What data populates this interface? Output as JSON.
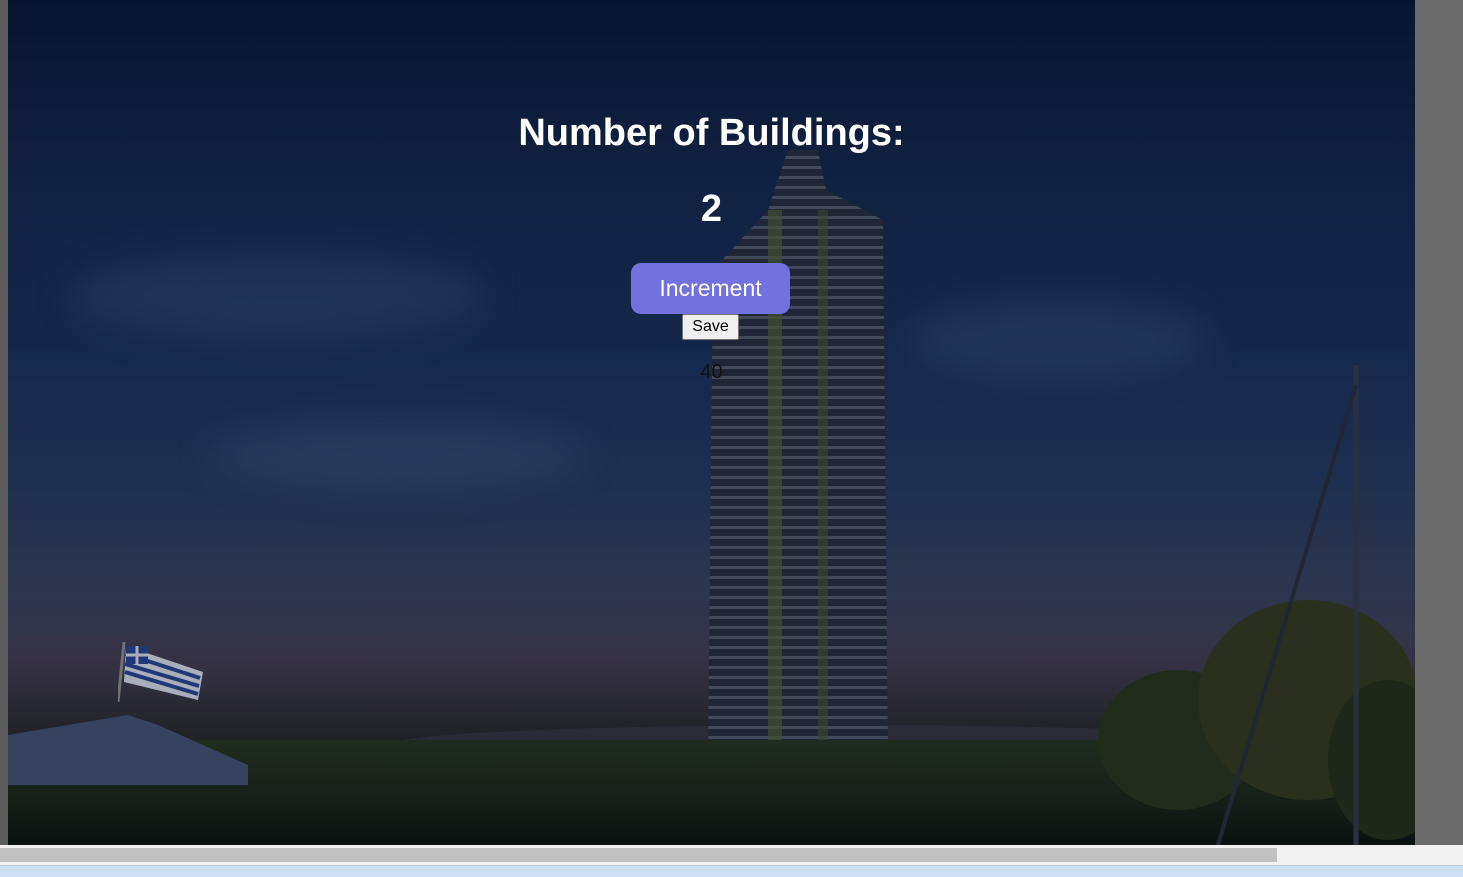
{
  "heading": {
    "label": "Number of Buildings:"
  },
  "counter": {
    "value": "2"
  },
  "buttons": {
    "increment_label": "Increment",
    "save_label": "Save"
  },
  "output": {
    "value": "40"
  },
  "colors": {
    "accent": "#7370e0",
    "heading_text": "#ffffff"
  }
}
